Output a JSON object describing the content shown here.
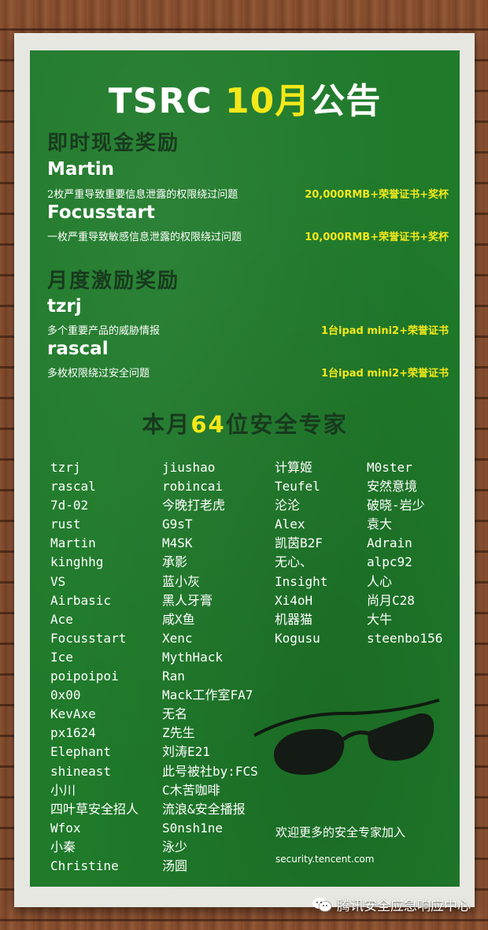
{
  "title": {
    "prefix": "TSRC ",
    "highlight": "10月",
    "suffix": "公告"
  },
  "instant_reward": {
    "heading": "即时现金奖励",
    "winners": [
      {
        "name": "Martin",
        "desc": "2枚严重导致重要信息泄露的权限绕过问题",
        "prize": "20,000RMB+荣誉证书+奖杯"
      },
      {
        "name": "Focusstart",
        "desc": "一枚严重导致敏感信息泄露的权限绕过问题",
        "prize": "10,000RMB+荣誉证书+奖杯"
      }
    ]
  },
  "monthly_reward": {
    "heading": "月度激励奖励",
    "winners": [
      {
        "name": "tzrj",
        "desc": "多个重要产品的威胁情报",
        "prize": "1台ipad mini2+荣誉证书"
      },
      {
        "name": "rascal",
        "desc": "多枚权限绕过安全问题",
        "prize": "1台ipad mini2+荣誉证书"
      }
    ]
  },
  "experts": {
    "heading": {
      "prefix": "本月",
      "highlight": "64",
      "suffix": "位安全专家"
    },
    "col1": [
      "tzrj",
      "rascal",
      "7d-02",
      "rust",
      "Martin",
      "kinghhg",
      "VS",
      "Airbasic",
      "Ace",
      "Focusstart",
      "Ice",
      "poipoipoi",
      "0x00",
      "KevAxe",
      "px1624",
      "Elephant",
      "shineast",
      "小川",
      "四叶草安全招人",
      "Wfox",
      "小秦",
      "Christine"
    ],
    "col2": [
      "jiushao",
      "robincai",
      "今晚打老虎",
      "G9sT",
      "M4SK",
      "承影",
      "蓝小灰",
      "黑人牙膏",
      "咸X鱼",
      "Xenc",
      "MythHack",
      "Ran",
      "Mack工作室FA7",
      "无名",
      "Z先生",
      "刘涛E21",
      "此号被社by:FCS",
      "C木苦咖啡",
      "流浪&安全播报",
      "S0nsh1ne",
      "泳少",
      "汤圆"
    ],
    "col3": [
      "计算姬",
      "Teufel",
      "沦沦",
      "Alex",
      "凯茵B2F",
      "无心、",
      "Insight",
      "Xi4oH",
      "机器猫",
      "Kogusu"
    ],
    "col4": [
      "M0ster",
      "安然意境",
      "破晓-岩少",
      "袁大",
      "Adrain",
      "alpc92",
      "人心",
      "尚月C28",
      "大牛",
      "steenbo156"
    ]
  },
  "welcome": "欢迎更多的安全专家加入",
  "url": "security.tencent.com",
  "wechat": {
    "icon": "wechat-icon",
    "label": "腾讯安全应急响应中心"
  },
  "colors": {
    "board": "#1f7a2a",
    "highlight": "#f3e81a",
    "heading": "#183a1e"
  }
}
